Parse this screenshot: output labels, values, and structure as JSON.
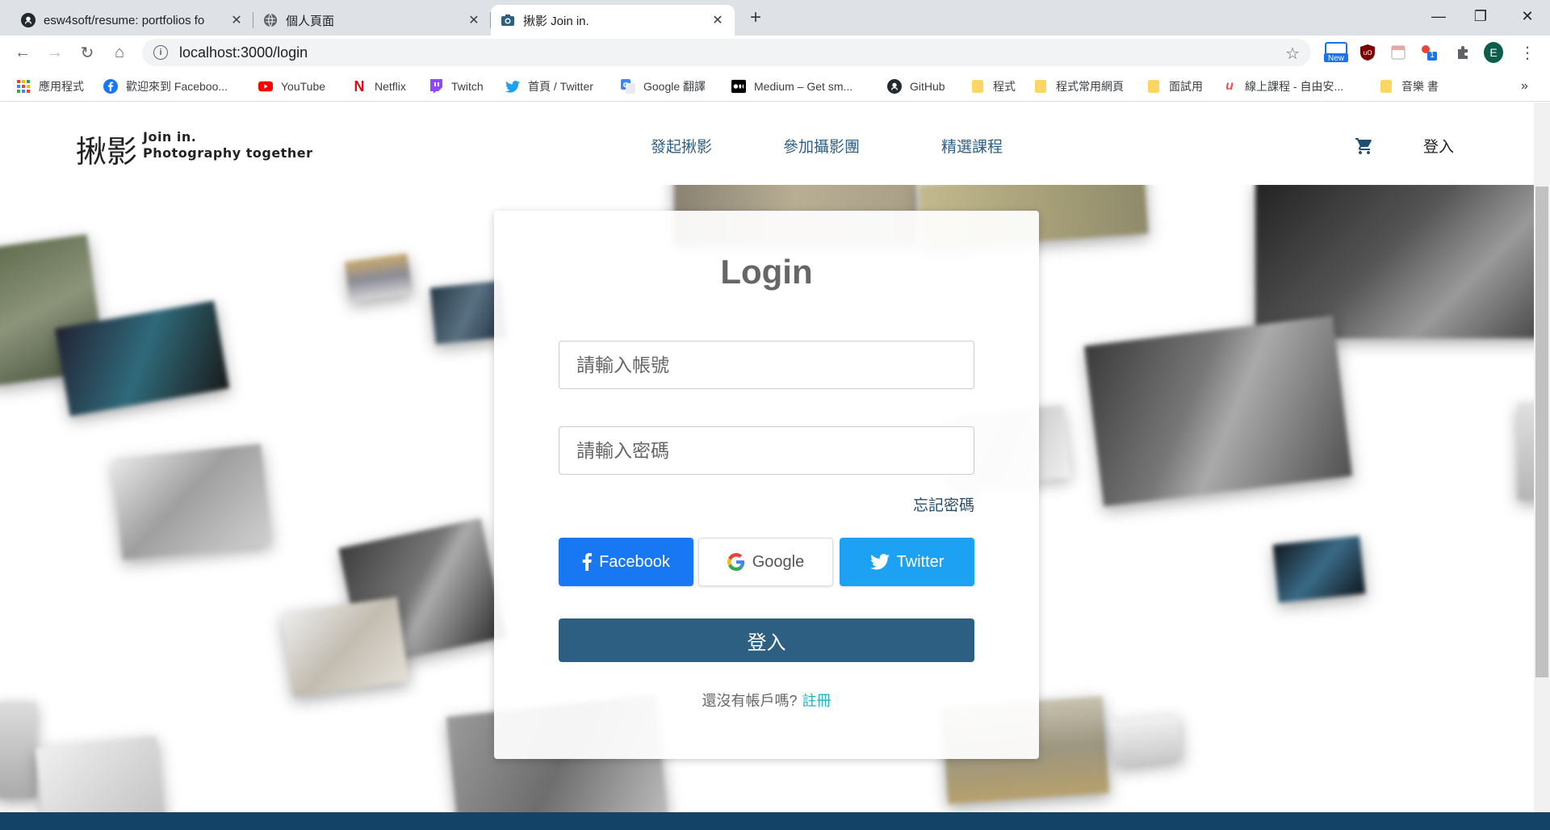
{
  "browser": {
    "tabs": [
      {
        "title": "esw4soft/resume: portfolios fo",
        "icon": "github-icon",
        "active": false
      },
      {
        "title": "個人頁面",
        "icon": "globe-icon",
        "active": false
      },
      {
        "title": "揪影 Join in.",
        "icon": "camera-icon",
        "active": true
      }
    ],
    "url": "localhost:3000/login",
    "profile_initial": "E",
    "bookmarks": [
      {
        "label": "應用程式",
        "icon": "apps-grid-icon"
      },
      {
        "label": "歡迎來到 Faceboo...",
        "icon": "facebook-icon"
      },
      {
        "label": "YouTube",
        "icon": "youtube-icon"
      },
      {
        "label": "Netflix",
        "icon": "netflix-icon"
      },
      {
        "label": "Twitch",
        "icon": "twitch-icon"
      },
      {
        "label": "首頁 / Twitter",
        "icon": "twitter-icon"
      },
      {
        "label": "Google 翻譯",
        "icon": "google-translate-icon"
      },
      {
        "label": "Medium – Get sm...",
        "icon": "medium-icon"
      },
      {
        "label": "GitHub",
        "icon": "github-icon"
      },
      {
        "label": "程式",
        "icon": "folder-icon"
      },
      {
        "label": "程式常用網頁",
        "icon": "folder-icon"
      },
      {
        "label": "面試用",
        "icon": "folder-icon"
      },
      {
        "label": "線上課程 - 自由安...",
        "icon": "udemy-icon"
      },
      {
        "label": "音樂 書",
        "icon": "folder-icon"
      }
    ],
    "more_bookmarks": "»",
    "ext_badge_new": "New",
    "ext_badge_count": "1"
  },
  "site": {
    "logo_cn": "揪影",
    "logo_en_line1": "Join in.",
    "logo_en_line2": "Photography together",
    "nav": [
      "發起揪影",
      "參加攝影團",
      "精選課程"
    ],
    "login_link": "登入"
  },
  "login": {
    "title": "Login",
    "account_placeholder": "請輸入帳號",
    "password_placeholder": "請輸入密碼",
    "forgot": "忘記密碼",
    "facebook": "Facebook",
    "google": "Google",
    "twitter": "Twitter",
    "submit": "登入",
    "no_account": "還沒有帳戶嗎?",
    "register": "註冊"
  },
  "colors": {
    "accent": "#2d5f82",
    "facebook": "#1877f2",
    "twitter": "#1da1f2",
    "register_link": "#20b2c8",
    "footer": "#134467"
  }
}
